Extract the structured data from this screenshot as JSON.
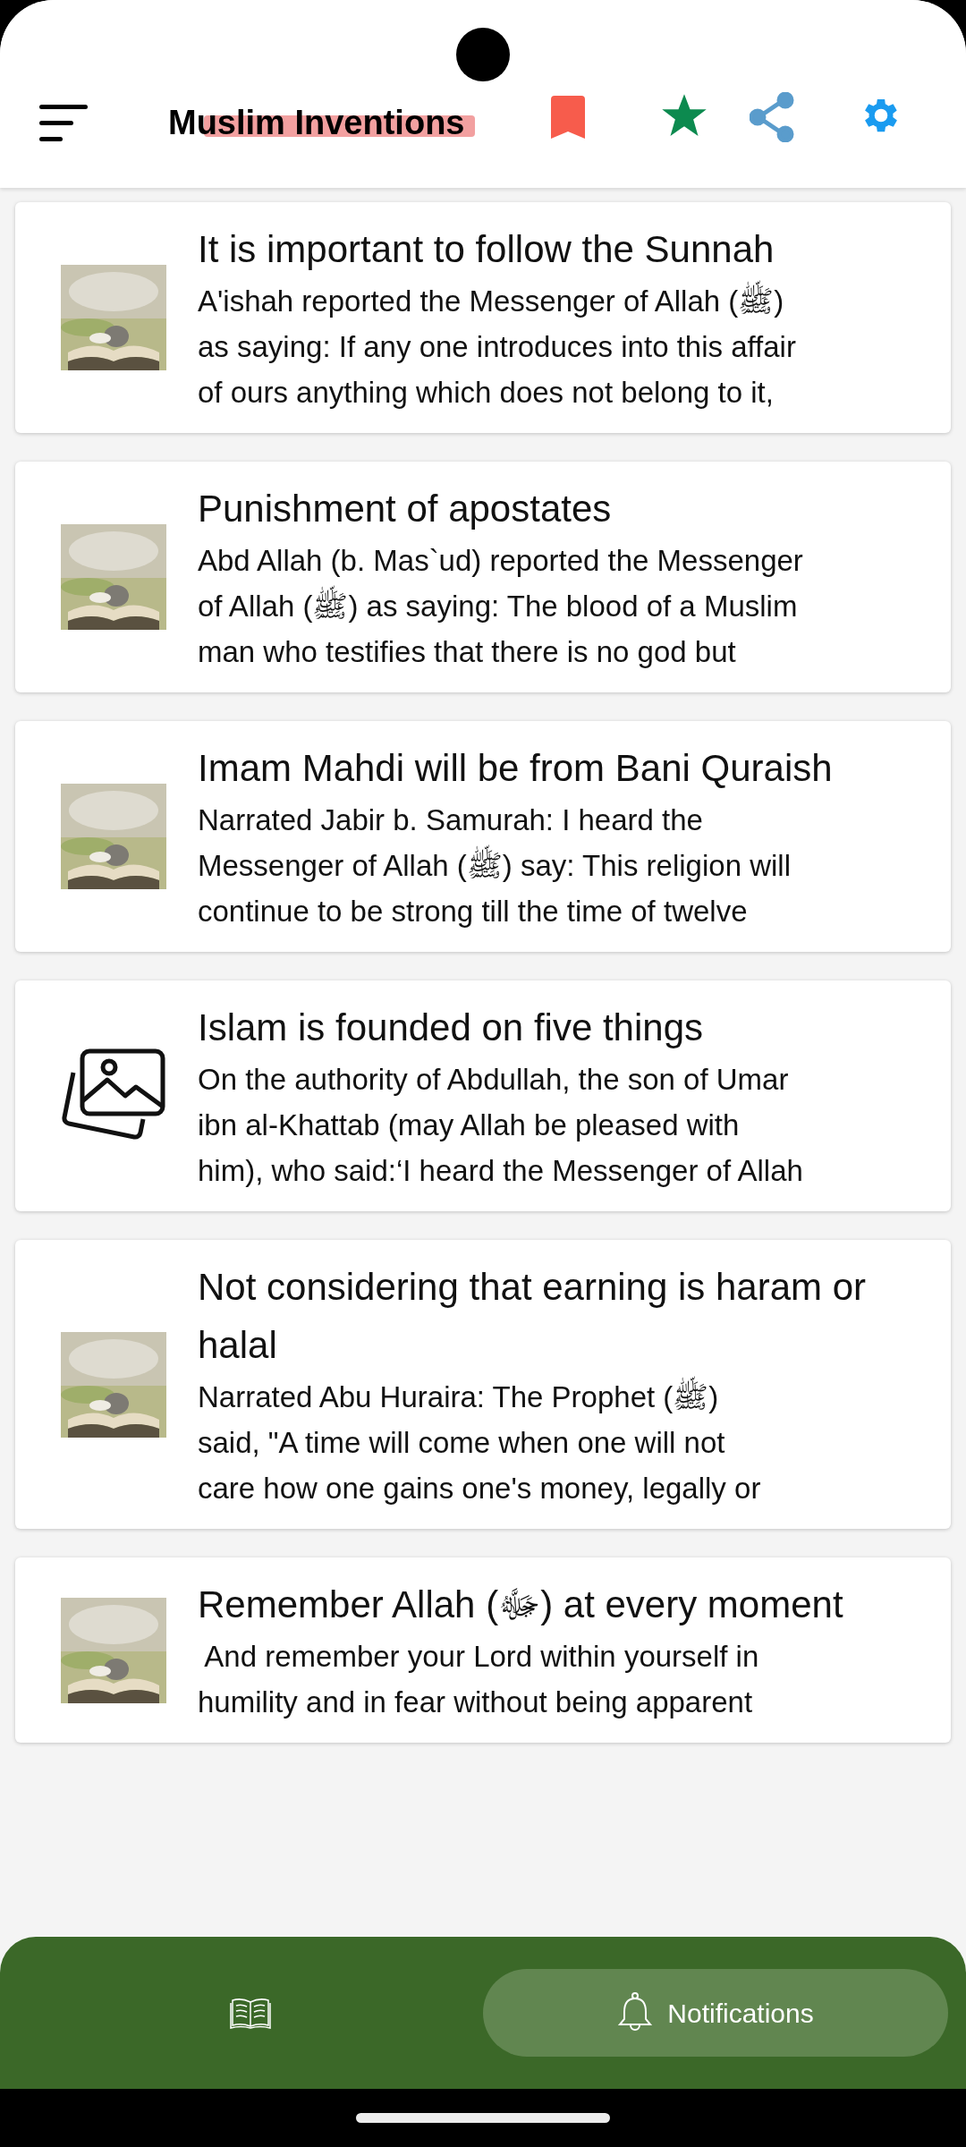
{
  "app_bar": {
    "title": "Muslim Inventions"
  },
  "cards": [
    {
      "kind": "picture",
      "title": "It is important to follow the Sunnah",
      "lines": [
        "A'ishah reported the Messenger of Allah (ﷺ)",
        "as saying: If any one introduces into this affair",
        "of ours anything which does not belong to it,"
      ]
    },
    {
      "kind": "picture",
      "title": "Punishment of apostates",
      "lines": [
        "Abd Allah (b. Mas`ud) reported the Messenger",
        "of Allah (ﷺ) as saying: The blood of a Muslim",
        "man who testifies that there is no god but"
      ]
    },
    {
      "kind": "picture",
      "title": "Imam Mahdi will be from Bani Quraish",
      "lines": [
        "Narrated Jabir b. Samurah: I heard the",
        "Messenger of Allah (ﷺ) say: This religion will",
        "continue to be strong till the time of twelve"
      ]
    },
    {
      "kind": "placeholder",
      "title": "Islam is founded on five things",
      "lines": [
        "On the authority of Abdullah, the son of Umar",
        "ibn al-Khattab (may Allah be pleased with",
        "him), who said:‘I heard the Messenger of Allah"
      ]
    },
    {
      "kind": "picture",
      "title": "Not considering that earning is haram or halal",
      "lines": [
        "Narrated Abu Huraira: The Prophet (ﷺ)",
        "said, \"A time will come when one will not",
        "care how one gains one's money, legally or"
      ]
    },
    {
      "kind": "picture",
      "title": "Remember Allah (ﷻ) at every moment",
      "lines": [
        " And remember your Lord within yourself in",
        "humility and in fear without being apparent"
      ]
    }
  ],
  "bottom_nav": [
    {
      "kind": "book",
      "selected": false
    },
    {
      "kind": "bell",
      "label": "Notifications",
      "selected": true
    }
  ]
}
